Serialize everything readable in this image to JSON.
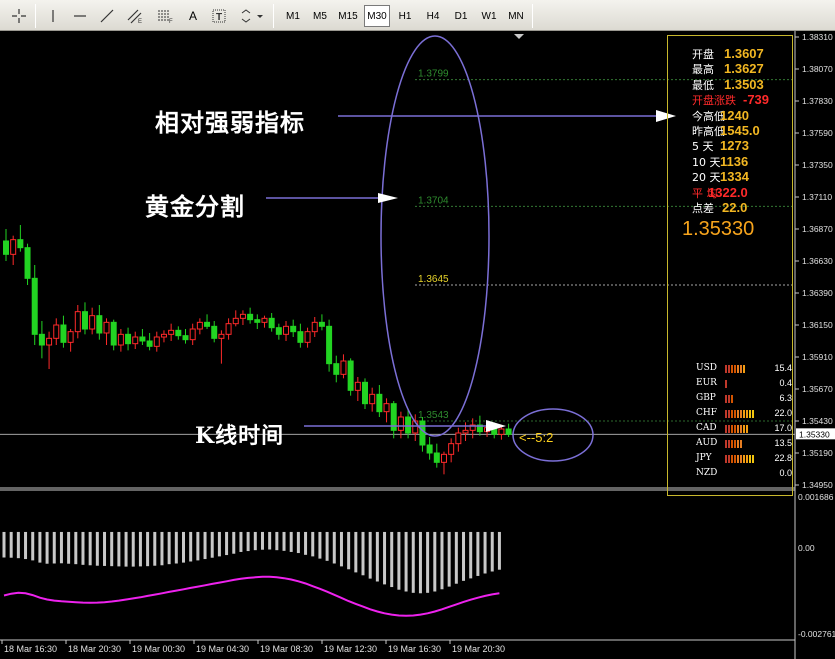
{
  "toolbar": {
    "timeframes": [
      "M1",
      "M5",
      "M15",
      "M30",
      "H1",
      "H4",
      "D1",
      "W1",
      "MN"
    ],
    "active_timeframe": "M30"
  },
  "annotations": {
    "rsi": "相对强弱指标",
    "gold_split": "黄金分割",
    "kline_time": "K线时间",
    "countdown": "<--5:2"
  },
  "fib_levels": [
    "1.3799",
    "1.3704",
    "1.3645",
    "1.3543"
  ],
  "info": {
    "rows": [
      {
        "label": "开盘",
        "value": "1.3607"
      },
      {
        "label": "最高",
        "value": "1.3627"
      },
      {
        "label": "最低",
        "value": "1.3503"
      },
      {
        "label": "开盘涨跌",
        "value": "-739",
        "red": true
      },
      {
        "label": "今高低",
        "value": "1240"
      },
      {
        "label": "昨高低",
        "value": "1545.0"
      },
      {
        "label": "5   天",
        "value": "1273"
      },
      {
        "label": "10  天",
        "value": "1136"
      },
      {
        "label": "20  天",
        "value": "1334"
      },
      {
        "label": "平   均",
        "value": "1322.0",
        "red": true
      },
      {
        "label": "点差",
        "value": "22.0"
      }
    ],
    "price": "1.35330",
    "currencies": [
      {
        "name": "USD",
        "value": "15.4",
        "strength": 0.7
      },
      {
        "name": "EUR",
        "value": "0.4",
        "strength": 0.05
      },
      {
        "name": "GBP",
        "value": "6.3",
        "strength": 0.3
      },
      {
        "name": "CHF",
        "value": "22.0",
        "strength": 1.0
      },
      {
        "name": "CAD",
        "value": "17.0",
        "strength": 0.75
      },
      {
        "name": "AUD",
        "value": "13.5",
        "strength": 0.6
      },
      {
        "name": "JPY",
        "value": "22.8",
        "strength": 1.0
      },
      {
        "name": "NZD",
        "value": "0.0",
        "strength": 0
      }
    ]
  },
  "price_axis": [
    "1.38310",
    "1.38070",
    "1.37830",
    "1.37590",
    "1.37350",
    "1.37110",
    "1.36870",
    "1.36630",
    "1.36390",
    "1.36150",
    "1.35910",
    "1.35670",
    "1.35430",
    "1.35190",
    "1.34950"
  ],
  "current_price_tag": "1.35330",
  "indicator_axis": [
    "0.001686",
    "0.00",
    "-0.002761"
  ],
  "time_axis": [
    "18 Mar 16:30",
    "18 Mar 20:30",
    "19 Mar 00:30",
    "19 Mar 04:30",
    "19 Mar 08:30",
    "19 Mar 12:30",
    "19 Mar 16:30",
    "19 Mar 20:30"
  ],
  "colors": {
    "bull": "#ff2a2a",
    "bear": "#22d422",
    "line": "#ee22ee",
    "histogram": "#c8c8c8",
    "panel_border": "#c8b82c",
    "accent": "#f2b722"
  },
  "candles": [
    [
      1.3678,
      1.3687,
      1.3663,
      1.3668
    ],
    [
      1.3668,
      1.3682,
      1.366,
      1.3679
    ],
    [
      1.3679,
      1.369,
      1.367,
      1.3673
    ],
    [
      1.3673,
      1.3676,
      1.3645,
      1.365
    ],
    [
      1.365,
      1.366,
      1.36,
      1.3608
    ],
    [
      1.3608,
      1.3618,
      1.359,
      1.36
    ],
    [
      1.36,
      1.361,
      1.3582,
      1.3605
    ],
    [
      1.3605,
      1.362,
      1.36,
      1.3615
    ],
    [
      1.3615,
      1.3622,
      1.3598,
      1.3602
    ],
    [
      1.3602,
      1.3612,
      1.3595,
      1.361
    ],
    [
      1.361,
      1.363,
      1.3605,
      1.3625
    ],
    [
      1.3625,
      1.3632,
      1.3608,
      1.3612
    ],
    [
      1.3612,
      1.3628,
      1.3608,
      1.3622
    ],
    [
      1.3622,
      1.363,
      1.3604,
      1.3609
    ],
    [
      1.3609,
      1.362,
      1.36,
      1.3617
    ],
    [
      1.3617,
      1.3619,
      1.3596,
      1.36
    ],
    [
      1.36,
      1.3612,
      1.3595,
      1.3608
    ],
    [
      1.3608,
      1.3613,
      1.3596,
      1.3601
    ],
    [
      1.3601,
      1.361,
      1.3597,
      1.3606
    ],
    [
      1.3606,
      1.3612,
      1.36,
      1.3603
    ],
    [
      1.3603,
      1.3609,
      1.3596,
      1.3599
    ],
    [
      1.3599,
      1.361,
      1.3595,
      1.3606
    ],
    [
      1.3606,
      1.3611,
      1.3602,
      1.3608
    ],
    [
      1.3608,
      1.3616,
      1.3603,
      1.3611
    ],
    [
      1.3611,
      1.3614,
      1.3604,
      1.3607
    ],
    [
      1.3607,
      1.3612,
      1.3601,
      1.3604
    ],
    [
      1.3604,
      1.3616,
      1.36,
      1.3612
    ],
    [
      1.3612,
      1.362,
      1.3608,
      1.3617
    ],
    [
      1.3617,
      1.3623,
      1.3612,
      1.3614
    ],
    [
      1.3614,
      1.3618,
      1.3602,
      1.3605
    ],
    [
      1.3605,
      1.3611,
      1.3586,
      1.3608
    ],
    [
      1.3608,
      1.362,
      1.3604,
      1.3616
    ],
    [
      1.3616,
      1.3626,
      1.3614,
      1.362
    ],
    [
      1.362,
      1.3626,
      1.3615,
      1.3623
    ],
    [
      1.3623,
      1.3628,
      1.3616,
      1.3619
    ],
    [
      1.3619,
      1.3623,
      1.3612,
      1.3617
    ],
    [
      1.3617,
      1.3622,
      1.3613,
      1.362
    ],
    [
      1.362,
      1.3624,
      1.361,
      1.3613
    ],
    [
      1.3613,
      1.3616,
      1.3604,
      1.3608
    ],
    [
      1.3608,
      1.3618,
      1.3603,
      1.3614
    ],
    [
      1.3614,
      1.3619,
      1.3606,
      1.361
    ],
    [
      1.361,
      1.3616,
      1.3598,
      1.3602
    ],
    [
      1.3602,
      1.3613,
      1.3598,
      1.361
    ],
    [
      1.361,
      1.3621,
      1.3606,
      1.3617
    ],
    [
      1.3617,
      1.3623,
      1.3611,
      1.3614
    ],
    [
      1.3614,
      1.3619,
      1.358,
      1.3586
    ],
    [
      1.3586,
      1.3592,
      1.3572,
      1.3578
    ],
    [
      1.3578,
      1.3593,
      1.3575,
      1.3588
    ],
    [
      1.3588,
      1.359,
      1.3562,
      1.3566
    ],
    [
      1.3566,
      1.3576,
      1.3558,
      1.3572
    ],
    [
      1.3572,
      1.3575,
      1.3552,
      1.3556
    ],
    [
      1.3556,
      1.3568,
      1.355,
      1.3563
    ],
    [
      1.3563,
      1.357,
      1.3546,
      1.355
    ],
    [
      1.355,
      1.356,
      1.3542,
      1.3556
    ],
    [
      1.3556,
      1.3558,
      1.353,
      1.3536
    ],
    [
      1.3536,
      1.355,
      1.353,
      1.3546
    ],
    [
      1.3546,
      1.3552,
      1.353,
      1.3534
    ],
    [
      1.3534,
      1.3548,
      1.3528,
      1.3543
    ],
    [
      1.3543,
      1.3546,
      1.352,
      1.3525
    ],
    [
      1.3525,
      1.3531,
      1.3514,
      1.3519
    ],
    [
      1.3519,
      1.3526,
      1.3508,
      1.3512
    ],
    [
      1.3512,
      1.352,
      1.3503,
      1.3518
    ],
    [
      1.3518,
      1.353,
      1.3512,
      1.3526
    ],
    [
      1.3526,
      1.3538,
      1.352,
      1.3534
    ],
    [
      1.3534,
      1.3542,
      1.3528,
      1.3536
    ],
    [
      1.3536,
      1.3545,
      1.353,
      1.354
    ],
    [
      1.354,
      1.3547,
      1.3532,
      1.3535
    ],
    [
      1.3535,
      1.3541,
      1.3531,
      1.3538
    ],
    [
      1.3538,
      1.3542,
      1.353,
      1.3533
    ],
    [
      1.3533,
      1.354,
      1.3529,
      1.3537
    ],
    [
      1.3537,
      1.3541,
      1.3531,
      1.3533
    ]
  ],
  "histogram": [
    0.00097,
    0.00097,
    0.00097,
    0.00097,
    0.00097,
    0.00097,
    0.00097,
    0.00097,
    0.00097,
    0.00097,
    0.00097,
    0.00097,
    0.00097,
    0.00097,
    0.00097,
    0.00097,
    0.00097,
    0.00097,
    0.00097,
    0.00097,
    0.00097,
    0.00097,
    0.00097,
    0.00097,
    0.00097,
    0.00097,
    0.00097,
    0.00097,
    0.00097,
    0.00097,
    0.00097,
    0.00097,
    0.00097,
    0.00097,
    0.00097,
    0.00097,
    0.00097,
    0.00097,
    0.00097,
    0.00097,
    0.00097,
    0.00097,
    0.00097,
    0.00097,
    0.00097,
    0.00097,
    0.00097,
    0.00097,
    0.00097,
    0.00097,
    0.00097,
    0.00097,
    0.00097,
    0.00097,
    0.00097,
    0.00097,
    0.00097,
    0.00097,
    0.00097,
    0.00097,
    0.00097,
    0.00097,
    0.00097,
    0.00097,
    0.00097,
    0.00097,
    0.00097,
    0.00097,
    0.00097,
    0.00097
  ],
  "histogram_low": [
    -0.00045,
    -0.00046,
    -0.00048,
    -0.00052,
    -0.00058,
    -0.00068,
    -0.00073,
    -0.00072,
    -0.00071,
    -0.00073,
    -0.00075,
    -0.00078,
    -0.0008,
    -0.00082,
    -0.00083,
    -0.00084,
    -0.00085,
    -0.00086,
    -0.00086,
    -0.00085,
    -0.00084,
    -0.00082,
    -0.0008,
    -0.00075,
    -0.00072,
    -0.00068,
    -0.00063,
    -0.00058,
    -0.00052,
    -0.00046,
    -0.0004,
    -0.00034,
    -0.00028,
    -0.0002,
    -0.00016,
    -0.00012,
    -0.0001,
    -9e-05,
    -0.00012,
    -0.00015,
    -0.0002,
    -0.00025,
    -0.00033,
    -0.0004,
    -0.0005,
    -0.0006,
    -0.00072,
    -0.00085,
    -0.00098,
    -0.00112,
    -0.00125,
    -0.0014,
    -0.00153,
    -0.00166,
    -0.00178,
    -0.0019,
    -0.00198,
    -0.00204,
    -0.00206,
    -0.00204,
    -0.00198,
    -0.00188,
    -0.00176,
    -0.00163,
    -0.0015,
    -0.00139,
    -0.00128,
    -0.00117,
    -0.00108,
    -0.001
  ],
  "signal_line": [
    -0.0008,
    -0.00072,
    -0.00068,
    -0.0007,
    -0.00078,
    -0.0009,
    -0.00098,
    -0.00103,
    -0.00106,
    -0.00108,
    -0.0011,
    -0.00112,
    -0.00113,
    -0.00112,
    -0.0011,
    -0.00107,
    -0.00103,
    -0.00098,
    -0.00093,
    -0.00088,
    -0.00082,
    -0.00076,
    -0.0007,
    -0.00064,
    -0.00058,
    -0.00052,
    -0.00046,
    -0.0004,
    -0.00034,
    -0.00028,
    -0.00022,
    -0.00016,
    -0.0001,
    -5e-05,
    -1e-05,
    2e-05,
    4e-05,
    4e-05,
    2e-05,
    -2e-05,
    -8e-05,
    -0.00016,
    -0.00026,
    -0.00038,
    -0.0005,
    -0.00063,
    -0.00077,
    -0.00091,
    -0.00105,
    -0.00118,
    -0.0013,
    -0.00142,
    -0.00152,
    -0.0016,
    -0.00166,
    -0.0017,
    -0.00171,
    -0.0017,
    -0.00166,
    -0.0016,
    -0.00152,
    -0.00142,
    -0.00131,
    -0.0012,
    -0.00109,
    -0.00099,
    -0.0009,
    -0.00082,
    -0.00075,
    -0.0007
  ]
}
